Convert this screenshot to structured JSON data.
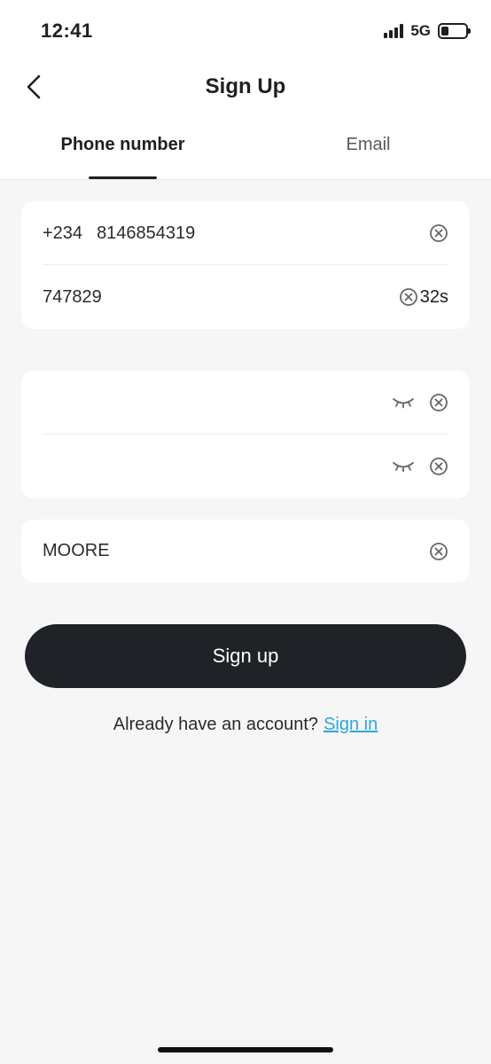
{
  "status_bar": {
    "time": "12:41",
    "network": "5G",
    "battery_level": 0.3
  },
  "header": {
    "title": "Sign Up",
    "back_icon": "chevron-left-icon"
  },
  "tabs": [
    {
      "label": "Phone number",
      "active": true
    },
    {
      "label": "Email",
      "active": false
    }
  ],
  "phone_card": {
    "country_code": "+234",
    "phone_value": "8146854319",
    "code_value": "747829",
    "countdown": "32s"
  },
  "password_card": {
    "password_value": "",
    "confirm_value": ""
  },
  "referral": {
    "value": "MOORE"
  },
  "signup_button_label": "Sign up",
  "signin": {
    "prompt": "Already have an account?",
    "link": "Sign in"
  },
  "colors": {
    "primary_button": "#1f2226",
    "link": "#2aa8dc",
    "background": "#f6f6f6"
  }
}
